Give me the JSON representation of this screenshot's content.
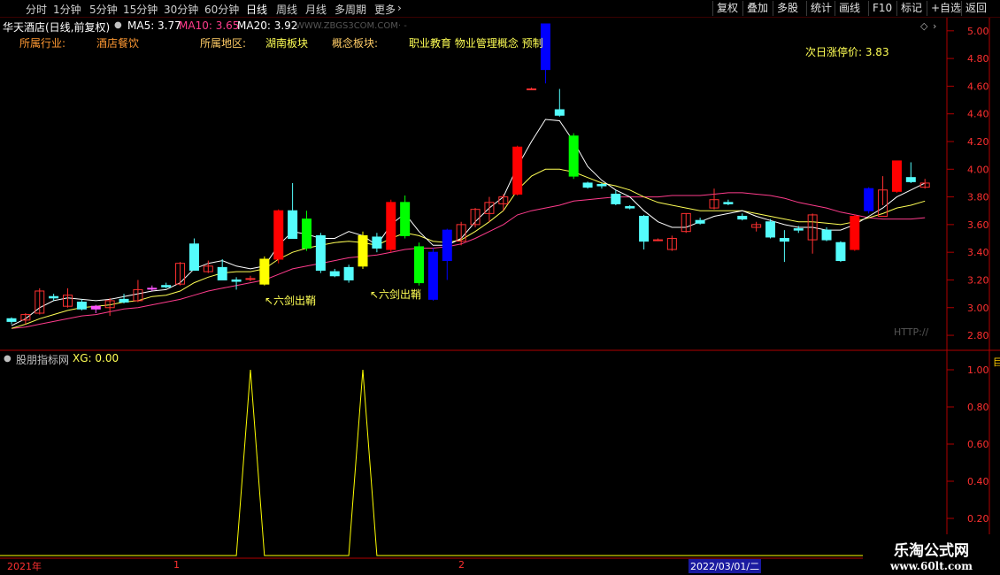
{
  "toolbar": {
    "timeframes": [
      "分时",
      "1分钟",
      "5分钟",
      "15分钟",
      "30分钟",
      "60分钟",
      "日线",
      "周线",
      "月线",
      "多周期",
      "更多"
    ],
    "active_timeframe": "日线",
    "buttons": [
      "复权",
      "叠加",
      "多股",
      "统计",
      "画线",
      "F10",
      "标记",
      "+自选",
      "返回"
    ]
  },
  "header": {
    "stock_name": "华天酒店(日线,前复权)",
    "ma5_label": "MA5: 3.77",
    "ma10_label": "MA10: 3.65",
    "ma20_label": "MA20: 3.92",
    "site_url": "WWW.ZBGS3COM.COM· -",
    "colors": {
      "ma5": "#ffffff",
      "ma10": "#ffff55",
      "ma20": "#ff3c8c"
    }
  },
  "info": {
    "industry_label": "所属行业:",
    "industry_value": "酒店餐饮",
    "region_label": "所属地区:",
    "region_value": "湖南板块",
    "concept_label": "概念板块:",
    "concept_value": "职业教育 物业管理概念 预制",
    "limit_price_label": "次日涨停价: 3.83"
  },
  "chart_data": [
    {
      "type": "candlestick",
      "y_ticks": [
        "5.00",
        "4.80",
        "4.60",
        "4.40",
        "4.20",
        "4.00",
        "3.80",
        "3.60",
        "3.40",
        "3.20",
        "3.00",
        "2.80"
      ],
      "ylim": [
        2.73,
        5.05
      ],
      "candles": [
        {
          "o": 2.92,
          "h": 2.93,
          "l": 2.88,
          "c": 2.9
        },
        {
          "o": 2.91,
          "h": 2.96,
          "l": 2.88,
          "c": 2.95
        },
        {
          "o": 2.96,
          "h": 3.14,
          "l": 2.95,
          "c": 3.12
        },
        {
          "o": 3.08,
          "h": 3.1,
          "l": 3.05,
          "c": 3.07
        },
        {
          "o": 3.01,
          "h": 3.14,
          "l": 3.0,
          "c": 3.09
        },
        {
          "o": 3.04,
          "h": 3.06,
          "l": 2.98,
          "c": 2.99
        },
        {
          "o": 2.99,
          "h": 3.02,
          "l": 2.96,
          "c": 3.01
        },
        {
          "o": 3.0,
          "h": 3.07,
          "l": 2.94,
          "c": 3.05
        },
        {
          "o": 3.06,
          "h": 3.1,
          "l": 3.03,
          "c": 3.04
        },
        {
          "o": 3.05,
          "h": 3.2,
          "l": 3.04,
          "c": 3.13
        },
        {
          "o": 3.14,
          "h": 3.16,
          "l": 3.12,
          "c": 3.14
        },
        {
          "o": 3.16,
          "h": 3.18,
          "l": 3.14,
          "c": 3.15
        },
        {
          "o": 3.17,
          "h": 3.33,
          "l": 3.16,
          "c": 3.32
        },
        {
          "o": 3.46,
          "h": 3.5,
          "l": 3.27,
          "c": 3.27
        },
        {
          "o": 3.26,
          "h": 3.34,
          "l": 3.25,
          "c": 3.3
        },
        {
          "o": 3.29,
          "h": 3.35,
          "l": 3.2,
          "c": 3.2
        },
        {
          "o": 3.2,
          "h": 3.22,
          "l": 3.13,
          "c": 3.19
        },
        {
          "o": 3.21,
          "h": 3.23,
          "l": 3.19,
          "c": 3.21
        },
        {
          "o": 3.17,
          "h": 3.37,
          "l": 3.16,
          "c": 3.35
        },
        {
          "o": 3.35,
          "h": 3.71,
          "l": 3.32,
          "c": 3.7
        },
        {
          "o": 3.7,
          "h": 3.9,
          "l": 3.52,
          "c": 3.5
        },
        {
          "o": 3.43,
          "h": 3.7,
          "l": 3.41,
          "c": 3.64
        },
        {
          "o": 3.52,
          "h": 3.54,
          "l": 3.25,
          "c": 3.27
        },
        {
          "o": 3.26,
          "h": 3.28,
          "l": 3.22,
          "c": 3.23
        },
        {
          "o": 3.29,
          "h": 3.31,
          "l": 3.18,
          "c": 3.2
        },
        {
          "o": 3.3,
          "h": 3.55,
          "l": 3.28,
          "c": 3.52
        },
        {
          "o": 3.51,
          "h": 3.54,
          "l": 3.4,
          "c": 3.43
        },
        {
          "o": 3.42,
          "h": 3.78,
          "l": 3.4,
          "c": 3.76
        },
        {
          "o": 3.76,
          "h": 3.81,
          "l": 3.5,
          "c": 3.52
        },
        {
          "o": 3.44,
          "h": 3.47,
          "l": 3.16,
          "c": 3.18
        },
        {
          "o": 3.4,
          "h": 3.43,
          "l": 3.05,
          "c": 3.06
        },
        {
          "o": 3.34,
          "h": 3.57,
          "l": 3.2,
          "c": 3.56
        },
        {
          "o": 3.48,
          "h": 3.62,
          "l": 3.45,
          "c": 3.6
        },
        {
          "o": 3.6,
          "h": 3.72,
          "l": 3.58,
          "c": 3.71
        },
        {
          "o": 3.68,
          "h": 3.8,
          "l": 3.62,
          "c": 3.76
        },
        {
          "o": 3.75,
          "h": 3.82,
          "l": 3.7,
          "c": 3.8
        },
        {
          "o": 3.82,
          "h": 4.17,
          "l": 3.81,
          "c": 4.16
        },
        {
          "o": 4.58,
          "h": 4.59,
          "l": 4.58,
          "c": 4.58
        },
        {
          "o": 5.05,
          "h": 5.05,
          "l": 4.62,
          "c": 4.72
        },
        {
          "o": 4.43,
          "h": 4.58,
          "l": 4.38,
          "c": 4.39
        },
        {
          "o": 4.24,
          "h": 4.26,
          "l": 3.93,
          "c": 3.95
        },
        {
          "o": 3.9,
          "h": 3.91,
          "l": 3.86,
          "c": 3.87
        },
        {
          "o": 3.89,
          "h": 3.9,
          "l": 3.86,
          "c": 3.88
        },
        {
          "o": 3.82,
          "h": 3.85,
          "l": 3.74,
          "c": 3.75
        },
        {
          "o": 3.73,
          "h": 3.74,
          "l": 3.71,
          "c": 3.72
        },
        {
          "o": 3.66,
          "h": 3.67,
          "l": 3.42,
          "c": 3.48
        },
        {
          "o": 3.49,
          "h": 3.5,
          "l": 3.48,
          "c": 3.49
        },
        {
          "o": 3.42,
          "h": 3.52,
          "l": 3.41,
          "c": 3.5
        },
        {
          "o": 3.55,
          "h": 3.68,
          "l": 3.54,
          "c": 3.68
        },
        {
          "o": 3.63,
          "h": 3.65,
          "l": 3.6,
          "c": 3.61
        },
        {
          "o": 3.72,
          "h": 3.86,
          "l": 3.71,
          "c": 3.78
        },
        {
          "o": 3.76,
          "h": 3.78,
          "l": 3.74,
          "c": 3.75
        },
        {
          "o": 3.66,
          "h": 3.68,
          "l": 3.63,
          "c": 3.64
        },
        {
          "o": 3.58,
          "h": 3.62,
          "l": 3.55,
          "c": 3.6
        },
        {
          "o": 3.62,
          "h": 3.64,
          "l": 3.5,
          "c": 3.51
        },
        {
          "o": 3.5,
          "h": 3.56,
          "l": 3.33,
          "c": 3.48
        },
        {
          "o": 3.57,
          "h": 3.59,
          "l": 3.54,
          "c": 3.56
        },
        {
          "o": 3.49,
          "h": 3.68,
          "l": 3.39,
          "c": 3.67
        },
        {
          "o": 3.56,
          "h": 3.58,
          "l": 3.48,
          "c": 3.49
        },
        {
          "o": 3.47,
          "h": 3.48,
          "l": 3.33,
          "c": 3.34
        },
        {
          "o": 3.42,
          "h": 3.67,
          "l": 3.41,
          "c": 3.66
        },
        {
          "o": 3.7,
          "h": 3.87,
          "l": 3.68,
          "c": 3.86
        },
        {
          "o": 3.66,
          "h": 3.95,
          "l": 3.74,
          "c": 3.85
        },
        {
          "o": 3.84,
          "h": 4.06,
          "l": 3.83,
          "c": 4.06
        },
        {
          "o": 3.94,
          "h": 4.05,
          "l": 3.9,
          "c": 3.91
        },
        {
          "o": 3.87,
          "h": 3.93,
          "l": 3.86,
          "c": 3.9
        }
      ],
      "ma5": [
        2.87,
        2.92,
        3.0,
        3.05,
        3.07,
        3.06,
        3.05,
        3.06,
        3.08,
        3.1,
        3.12,
        3.13,
        3.18,
        3.28,
        3.32,
        3.34,
        3.3,
        3.28,
        3.3,
        3.45,
        3.55,
        3.53,
        3.5,
        3.5,
        3.55,
        3.52,
        3.45,
        3.6,
        3.68,
        3.55,
        3.45,
        3.45,
        3.5,
        3.62,
        3.72,
        3.8,
        4.02,
        4.2,
        4.36,
        4.35,
        4.2,
        4.02,
        3.92,
        3.85,
        3.8,
        3.7,
        3.62,
        3.58,
        3.58,
        3.62,
        3.66,
        3.68,
        3.7,
        3.66,
        3.63,
        3.6,
        3.58,
        3.58,
        3.56,
        3.56,
        3.6,
        3.66,
        3.72,
        3.8,
        3.85,
        3.9
      ],
      "ma10": [
        2.85,
        2.88,
        2.92,
        2.95,
        2.98,
        3.0,
        3.01,
        3.02,
        3.04,
        3.05,
        3.08,
        3.09,
        3.12,
        3.18,
        3.22,
        3.25,
        3.26,
        3.26,
        3.28,
        3.35,
        3.4,
        3.43,
        3.45,
        3.47,
        3.48,
        3.47,
        3.45,
        3.5,
        3.54,
        3.52,
        3.48,
        3.47,
        3.49,
        3.55,
        3.62,
        3.7,
        3.85,
        3.95,
        4.0,
        4.0,
        3.98,
        3.94,
        3.9,
        3.88,
        3.85,
        3.8,
        3.76,
        3.74,
        3.72,
        3.7,
        3.7,
        3.7,
        3.7,
        3.68,
        3.66,
        3.64,
        3.62,
        3.62,
        3.61,
        3.6,
        3.62,
        3.65,
        3.68,
        3.72,
        3.74,
        3.77
      ],
      "ma20": [
        2.85,
        2.86,
        2.88,
        2.9,
        2.92,
        2.94,
        2.95,
        2.97,
        2.99,
        3.0,
        3.02,
        3.04,
        3.06,
        3.09,
        3.12,
        3.14,
        3.16,
        3.18,
        3.2,
        3.24,
        3.28,
        3.3,
        3.32,
        3.34,
        3.36,
        3.37,
        3.38,
        3.4,
        3.42,
        3.43,
        3.43,
        3.44,
        3.46,
        3.5,
        3.55,
        3.6,
        3.67,
        3.7,
        3.72,
        3.74,
        3.77,
        3.78,
        3.79,
        3.8,
        3.8,
        3.8,
        3.8,
        3.81,
        3.81,
        3.81,
        3.82,
        3.83,
        3.83,
        3.82,
        3.81,
        3.79,
        3.76,
        3.74,
        3.72,
        3.69,
        3.67,
        3.65,
        3.64,
        3.64,
        3.64,
        3.65
      ],
      "colors": {
        "up_red": "#ff3030",
        "down_cyan": "#54fcfc",
        "signal_up": "#ffff00",
        "signal_up2": "#ff0000",
        "signal_down": "#0000ff",
        "signal_down2": "#00ff00",
        "up_hollow": "#ff3030",
        "doji_pink": "#ff55ff"
      }
    },
    {
      "type": "line",
      "title": "股朋指标网",
      "y_ticks": [
        "1.00",
        "0.80",
        "0.60",
        "0.40",
        "0.20"
      ],
      "ylim": [
        0,
        1
      ],
      "xg_label": "XG: 0.00",
      "values": [
        0,
        0,
        0,
        0,
        0,
        0,
        0,
        0,
        0,
        0,
        0,
        0,
        0,
        0,
        0,
        0,
        0,
        1,
        0,
        0,
        0,
        0,
        0,
        0,
        0,
        1,
        0,
        0,
        0,
        0,
        0,
        0,
        0,
        0,
        0,
        0,
        0,
        0,
        0,
        0,
        0,
        0,
        0,
        0,
        0,
        0,
        0,
        0,
        0,
        0,
        0,
        0,
        0,
        0,
        0,
        0,
        0,
        0,
        0,
        0,
        0,
        0,
        0,
        0,
        0,
        0
      ],
      "signal_indices": [
        17,
        25
      ],
      "color": "#ffff00"
    }
  ],
  "signals": {
    "label": "↖六剑出鞘",
    "color": "#ffff55"
  },
  "http_label": "HTTP://",
  "datebar": {
    "year": "2021年",
    "m1": "1",
    "m2": "2",
    "cursor_date": "2022/03/01/二"
  },
  "watermark": {
    "line1": "乐淘公式网",
    "line2": "www.60lt.com"
  }
}
